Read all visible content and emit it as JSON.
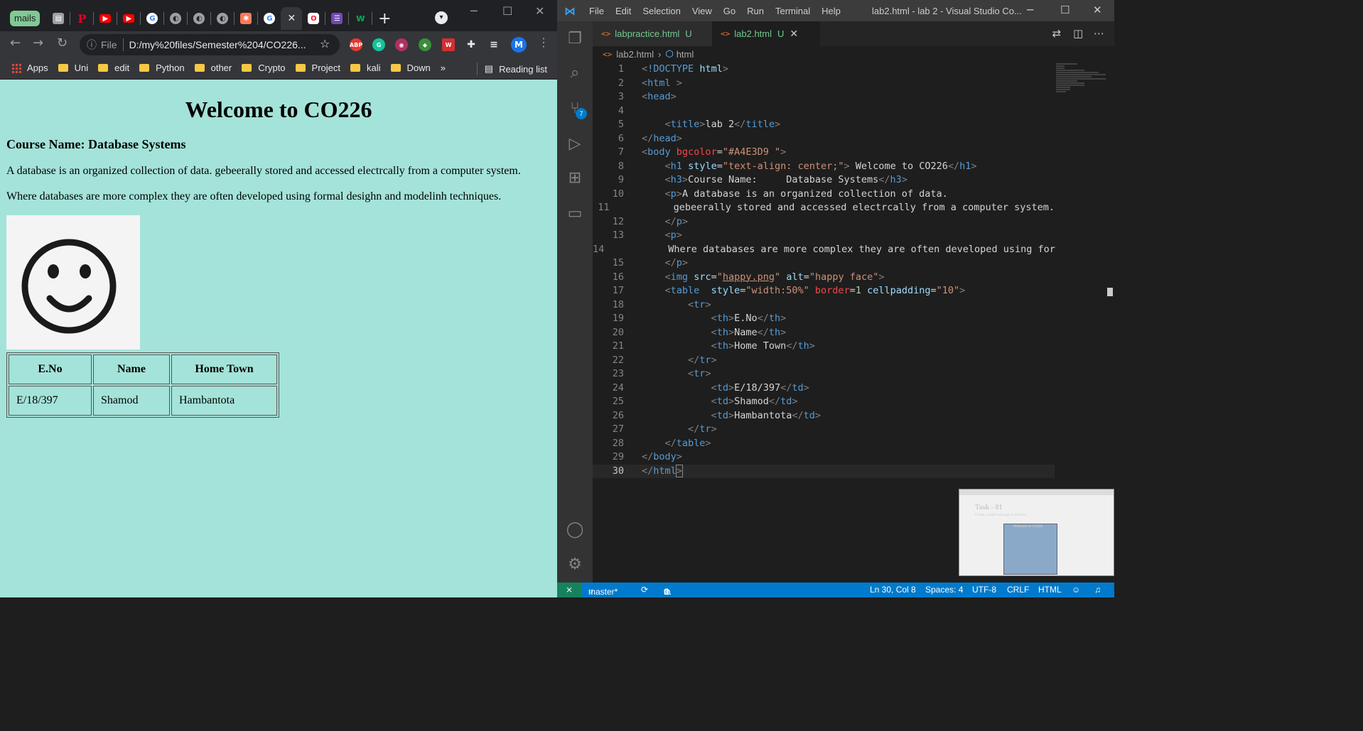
{
  "browser": {
    "tab_group": "mails",
    "tabs": [
      {
        "icon": "docs-icon",
        "color": "#9aa0a6"
      },
      {
        "icon": "pinterest-icon",
        "color": "#e60023"
      },
      {
        "icon": "youtube-icon",
        "color": "#ff0000"
      },
      {
        "icon": "youtube-icon",
        "color": "#ff0000"
      },
      {
        "icon": "google-icon",
        "color": "#ffffff"
      },
      {
        "icon": "globe-icon",
        "color": "#9aa0a6"
      },
      {
        "icon": "globe-icon",
        "color": "#9aa0a6"
      },
      {
        "icon": "globe-icon",
        "color": "#9aa0a6"
      },
      {
        "icon": "hubspot-icon",
        "color": "#ff7a59"
      },
      {
        "icon": "google-icon",
        "color": "#ffffff"
      },
      {
        "icon": "close-icon",
        "color": "#e8eaed"
      },
      {
        "icon": "opera-icon",
        "color": "#ff1b2d"
      },
      {
        "icon": "forms-icon",
        "color": "#7248b9"
      },
      {
        "icon": "webflow-icon",
        "color": "#0f9d58"
      }
    ],
    "url_scheme": "File",
    "url": "D:/my%20files/Semester%204/CO226...",
    "bookmarks": [
      "Apps",
      "Uni",
      "edit",
      "Python",
      "other",
      "Crypto",
      "Project",
      "kali",
      "Down"
    ],
    "more": "»",
    "reading_list": "Reading list",
    "profile": "M"
  },
  "page": {
    "background": "#a4e3d9",
    "heading": "Welcome to CO226",
    "course": "Course Name: Database Systems",
    "p1": "A database is an organized collection of data. gebeerally stored and accessed electrcally from a computer system.",
    "p2": "Where databases are more complex they are often developed using formal desighn and modelinh techniques.",
    "image_alt": "happy face",
    "table": {
      "headers": [
        "E.No",
        "Name",
        "Home Town"
      ],
      "rows": [
        [
          "E/18/397",
          "Shamod",
          "Hambantota"
        ]
      ]
    }
  },
  "vscode": {
    "menu": [
      "File",
      "Edit",
      "Selection",
      "View",
      "Go",
      "Run",
      "Terminal",
      "Help"
    ],
    "window_title": "lab2.html - lab 2 - Visual Studio Co...",
    "tabs": [
      {
        "name": "labpractice.html",
        "status": "U"
      },
      {
        "name": "lab2.html",
        "status": "U"
      }
    ],
    "breadcrumb": [
      "lab2.html",
      "html"
    ],
    "scm_badge": "7",
    "current_line": "30",
    "status": {
      "branch": "master*",
      "errors": "0",
      "warnings": "0",
      "position": "Ln 30, Col 8",
      "spaces": "Spaces: 4",
      "encoding": "UTF-8",
      "eol": "CRLF",
      "language": "HTML"
    },
    "preview": {
      "title": "Task - 01",
      "subtitle": "Create a small web page as follows:",
      "inner_title": "Welcome to CO226"
    }
  }
}
